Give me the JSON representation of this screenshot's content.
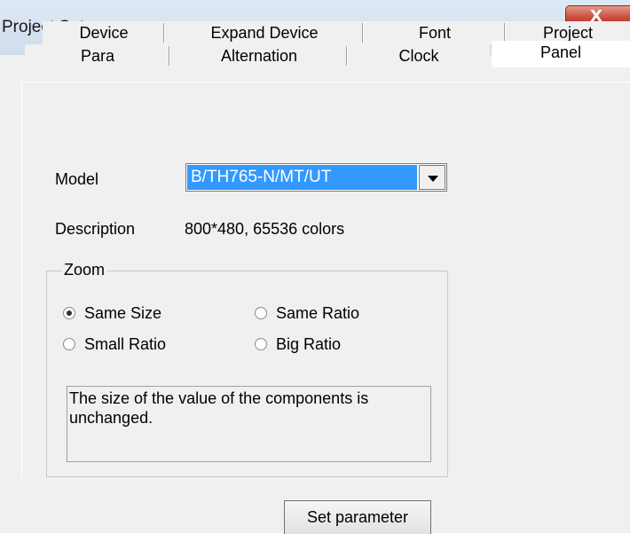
{
  "window": {
    "title": "Project Set",
    "close_label": "X"
  },
  "tabs": {
    "row1": [
      "Device",
      "Expand Device",
      "Font",
      "Project"
    ],
    "row2": [
      "Para",
      "Alternation",
      "Clock",
      "Panel"
    ],
    "active": "Panel"
  },
  "panel": {
    "model_label": "Model",
    "model_value": "B/TH765-N/MT/UT",
    "description_label": "Description",
    "description_value": "800*480, 65536 colors",
    "zoom": {
      "legend": "Zoom",
      "options": [
        "Same Size",
        "Same Ratio",
        "Small Ratio",
        "Big Ratio"
      ],
      "selected": "Same Size",
      "explanation": "The size of the value of the components is unchanged."
    },
    "set_parameter_label": "Set parameter"
  },
  "icons": {
    "close": "close-icon",
    "dropdown": "chevron-down-icon"
  },
  "colors": {
    "selection": "#3399ff",
    "close_button": "#c8483a"
  }
}
